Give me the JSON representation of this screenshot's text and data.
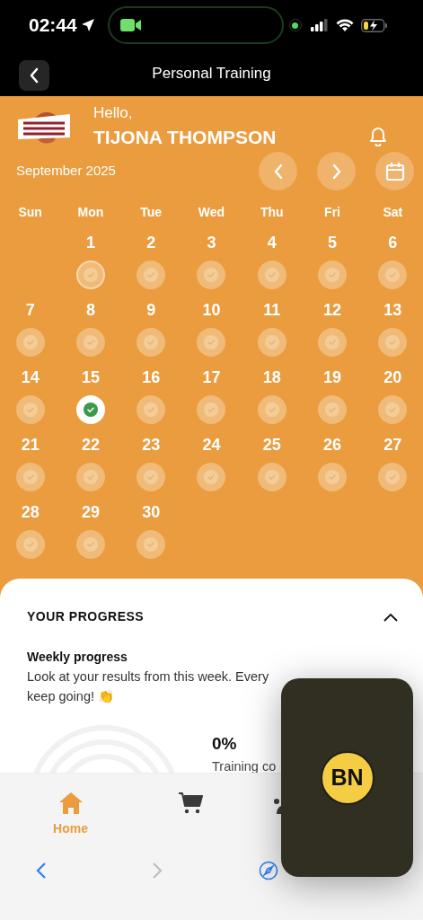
{
  "status_bar": {
    "time": "02:44"
  },
  "nav_bar": {
    "title": "Personal Training"
  },
  "header": {
    "greeting": "Hello,",
    "name": "TIJONA THOMPSON",
    "month": "September 2025"
  },
  "calendar": {
    "weekdays": [
      "Sun",
      "Mon",
      "Tue",
      "Wed",
      "Thu",
      "Fri",
      "Sat"
    ],
    "days": [
      {
        "day": "1",
        "done": false,
        "today": true
      },
      {
        "day": "2",
        "done": false,
        "today": false
      },
      {
        "day": "3",
        "done": false,
        "today": false
      },
      {
        "day": "4",
        "done": false,
        "today": false
      },
      {
        "day": "5",
        "done": false,
        "today": false
      },
      {
        "day": "6",
        "done": false,
        "today": false
      },
      {
        "day": "7",
        "done": false,
        "today": false
      },
      {
        "day": "8",
        "done": false,
        "today": false
      },
      {
        "day": "9",
        "done": false,
        "today": false
      },
      {
        "day": "10",
        "done": false,
        "today": false
      },
      {
        "day": "11",
        "done": false,
        "today": false
      },
      {
        "day": "12",
        "done": false,
        "today": false
      },
      {
        "day": "13",
        "done": false,
        "today": false
      },
      {
        "day": "14",
        "done": false,
        "today": false
      },
      {
        "day": "15",
        "done": true,
        "today": false
      },
      {
        "day": "16",
        "done": false,
        "today": false
      },
      {
        "day": "17",
        "done": false,
        "today": false
      },
      {
        "day": "18",
        "done": false,
        "today": false
      },
      {
        "day": "19",
        "done": false,
        "today": false
      },
      {
        "day": "20",
        "done": false,
        "today": false
      },
      {
        "day": "21",
        "done": false,
        "today": false
      },
      {
        "day": "22",
        "done": false,
        "today": false
      },
      {
        "day": "23",
        "done": false,
        "today": false
      },
      {
        "day": "24",
        "done": false,
        "today": false
      },
      {
        "day": "25",
        "done": false,
        "today": false
      },
      {
        "day": "26",
        "done": false,
        "today": false
      },
      {
        "day": "27",
        "done": false,
        "today": false
      },
      {
        "day": "28",
        "done": false,
        "today": false
      },
      {
        "day": "29",
        "done": false,
        "today": false
      },
      {
        "day": "30",
        "done": false,
        "today": false
      }
    ]
  },
  "progress": {
    "title": "YOUR PROGRESS",
    "expanded": true,
    "subtitle": "Weekly progress",
    "text_lines": [
      "Look at your results from this week. Every",
      "keep going! 👏"
    ],
    "percent": "0%",
    "percent_label": "Training co"
  },
  "tab_bar": [
    {
      "kind": "home",
      "label": "Home",
      "selected": true
    },
    {
      "kind": "cart",
      "selected": false
    },
    {
      "kind": "people",
      "selected": false
    }
  ],
  "overlay": {
    "initials": "BN"
  }
}
